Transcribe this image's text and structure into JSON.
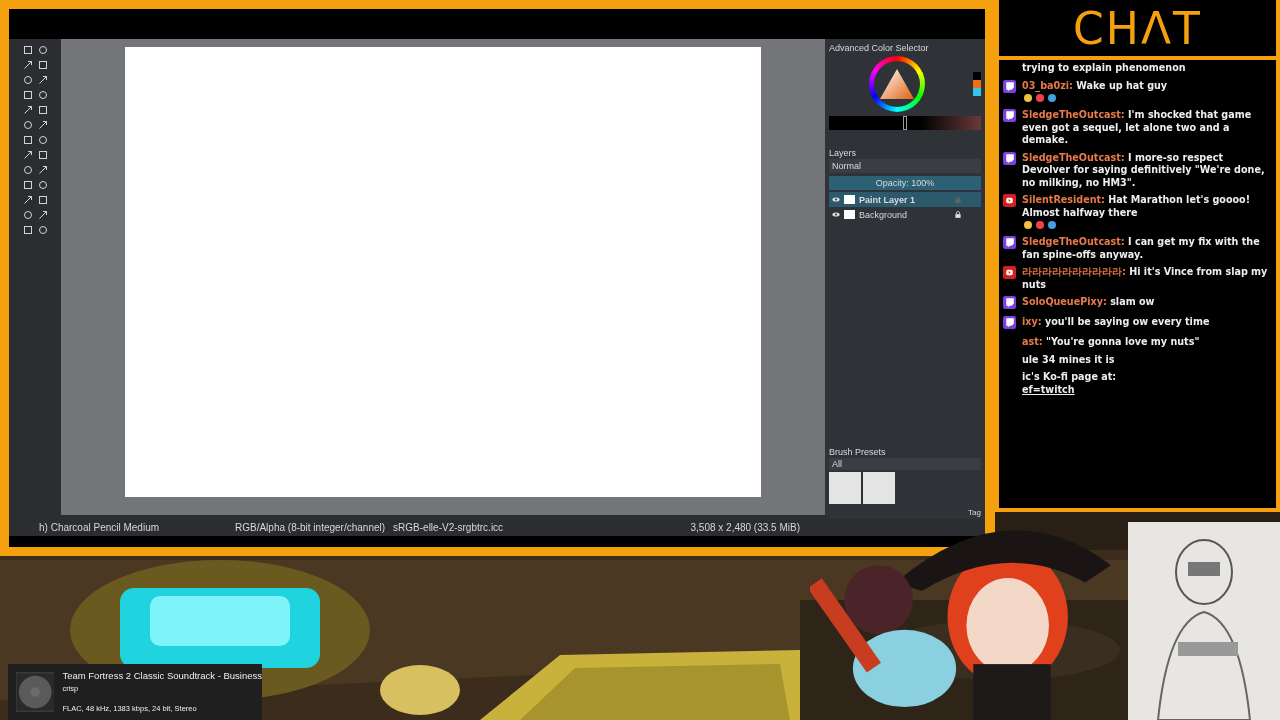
{
  "krita": {
    "color_selector": {
      "title": "Advanced Color Selector",
      "shade_slider": {
        "level": 0.5
      }
    },
    "layers": {
      "title": "Layers",
      "blend_mode": "Normal",
      "opacity": "Opacity:  100%",
      "opacity_slider": {
        "level": 1
      },
      "items": [
        {
          "name": "Paint Layer 1",
          "selected": true,
          "locked": false
        },
        {
          "name": "Background",
          "selected": false,
          "locked": true
        }
      ]
    },
    "brush_presets": {
      "title": "Brush Presets",
      "filter": "All",
      "tag": "Tag"
    },
    "status_bar": {
      "brush": "h) Charcoal Pencil Medium",
      "color_space": "RGB/Alpha (8-bit integer/channel)",
      "profile": "sRGB-elle-V2-srgbtrc.icc",
      "size": "3,508 x 2,480 (33.5 MiB)"
    }
  },
  "chat": {
    "logo": "CHΛT",
    "messages": [
      {
        "text": "trying to explain phenomenon"
      },
      {
        "kind": "twitch",
        "user": "03_ba0zi:",
        "text": "Wake up hat guy",
        "emotes": true
      },
      {
        "kind": "twitch",
        "user": "SledgeTheOutcast:",
        "text": "I'm shocked that game even got a sequel, let alone two and a demake."
      },
      {
        "kind": "twitch",
        "user": "SledgeTheOutcast:",
        "text": "I more-so respect Devolver for saying definitively \"We're done, no milking, no HM3\"."
      },
      {
        "kind": "youtube",
        "user": "SilentResident:",
        "text": "Hat Marathon let's goooo! Almost halfway there",
        "emotes": true
      },
      {
        "kind": "twitch",
        "user": "SledgeTheOutcast:",
        "text": "I can get my fix with the fan spine-offs anyway."
      },
      {
        "kind": "youtube",
        "user": "라라라라라라라라라라:",
        "text": "Hi it's Vince from slap my nuts"
      },
      {
        "kind": "twitch",
        "user": "SoloQueuePixy:",
        "text": "slam ow"
      },
      {
        "kind": "twitch",
        "user": "ixy:",
        "text": "you'll be saying ow every time"
      },
      {
        "user": "ast:",
        "text": "\"You're gonna love my nuts\""
      },
      {
        "text": "ule 34 mines it is"
      },
      {
        "text": "ic's Ko-fi page at:",
        "link": "ef=twitch"
      }
    ]
  },
  "now_playing": {
    "title": "Team Fortress 2 Classic Soundtrack - Business",
    "artist": "crisp",
    "format": "FLAC, 48 kHz, 1383 kbps, 24 bit, Stereo"
  }
}
